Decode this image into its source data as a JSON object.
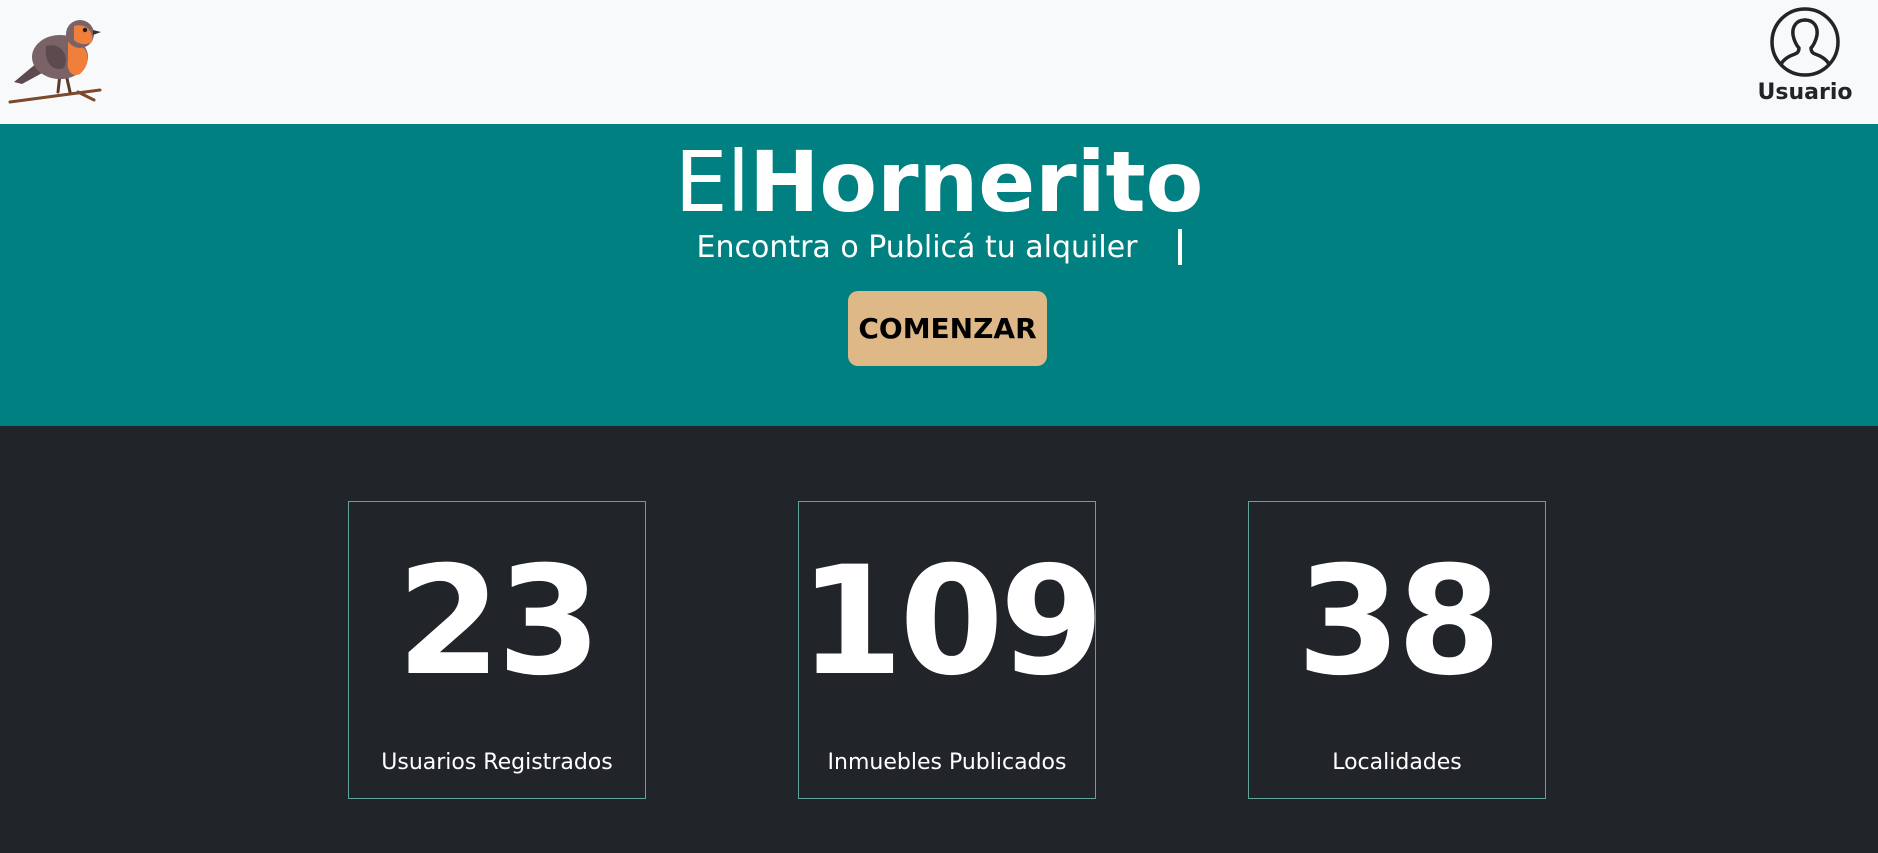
{
  "navbar": {
    "logo_icon": "robin-bird-logo-icon",
    "user_icon": "user-avatar-icon",
    "user_label": "Usuario"
  },
  "hero": {
    "brand_light": "El",
    "brand_bold": "Hornerito",
    "subtitle": "Encontra o Publicá tu alquiler",
    "start_button": "COMENZAR",
    "colors": {
      "background": "#008080",
      "button": "#deb887"
    }
  },
  "stats": {
    "items": [
      {
        "value": "23",
        "label": "Usuarios Registrados"
      },
      {
        "value": "109",
        "label": "Inmuebles Publicados"
      },
      {
        "value": "38",
        "label": "Localidades"
      }
    ],
    "colors": {
      "background": "#212428",
      "border": "#5fa39a"
    }
  }
}
